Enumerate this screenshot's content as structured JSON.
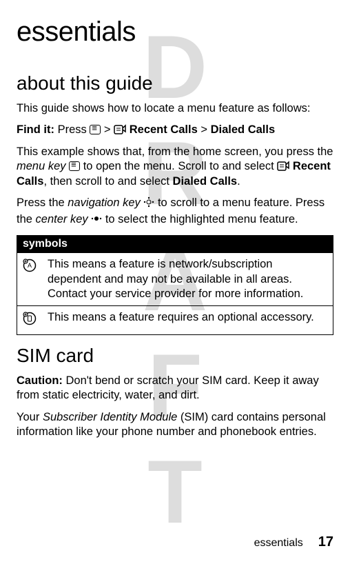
{
  "watermark": "DRAFT",
  "title": "essentials",
  "section_about": "about this guide",
  "p1": "This guide shows how to locate a menu feature as follows:",
  "findit_label": "Find it:",
  "findit_press": " Press ",
  "gt": " > ",
  "recent_calls": " Recent Calls",
  "dialed_calls": "Dialed Calls",
  "p2a": "This example shows that, from the home screen, you press the ",
  "p2b": "menu key",
  "p2c": " to open the menu. Scroll to and select ",
  "p2d": "Recent Calls",
  "p2e": ", then scroll to and select ",
  "p2f": "Dialed Calls",
  "p2g": ".",
  "p3a": "Press the ",
  "p3b": "navigation key",
  "p3c": " to scroll to a menu feature. Press the ",
  "p3d": "center key",
  "p3e": " to select the highlighted menu feature.",
  "symbols_header": "symbols",
  "sym1": "This means a feature is network/subscription dependent and may not be available in all areas. Contact your service provider for more information.",
  "sym2": "This means a feature requires an optional accessory.",
  "section_sim": "SIM card",
  "sim_caution_label": "Caution:",
  "sim_caution": " Don't bend or scratch your SIM card. Keep it away from static electricity, water, and dirt.",
  "sim_p2a": "Your ",
  "sim_p2b": "Subscriber Identity Module",
  "sim_p2c": " (SIM) card contains personal information like your phone number and phonebook entries.",
  "footer_label": "essentials",
  "page_number": "17"
}
